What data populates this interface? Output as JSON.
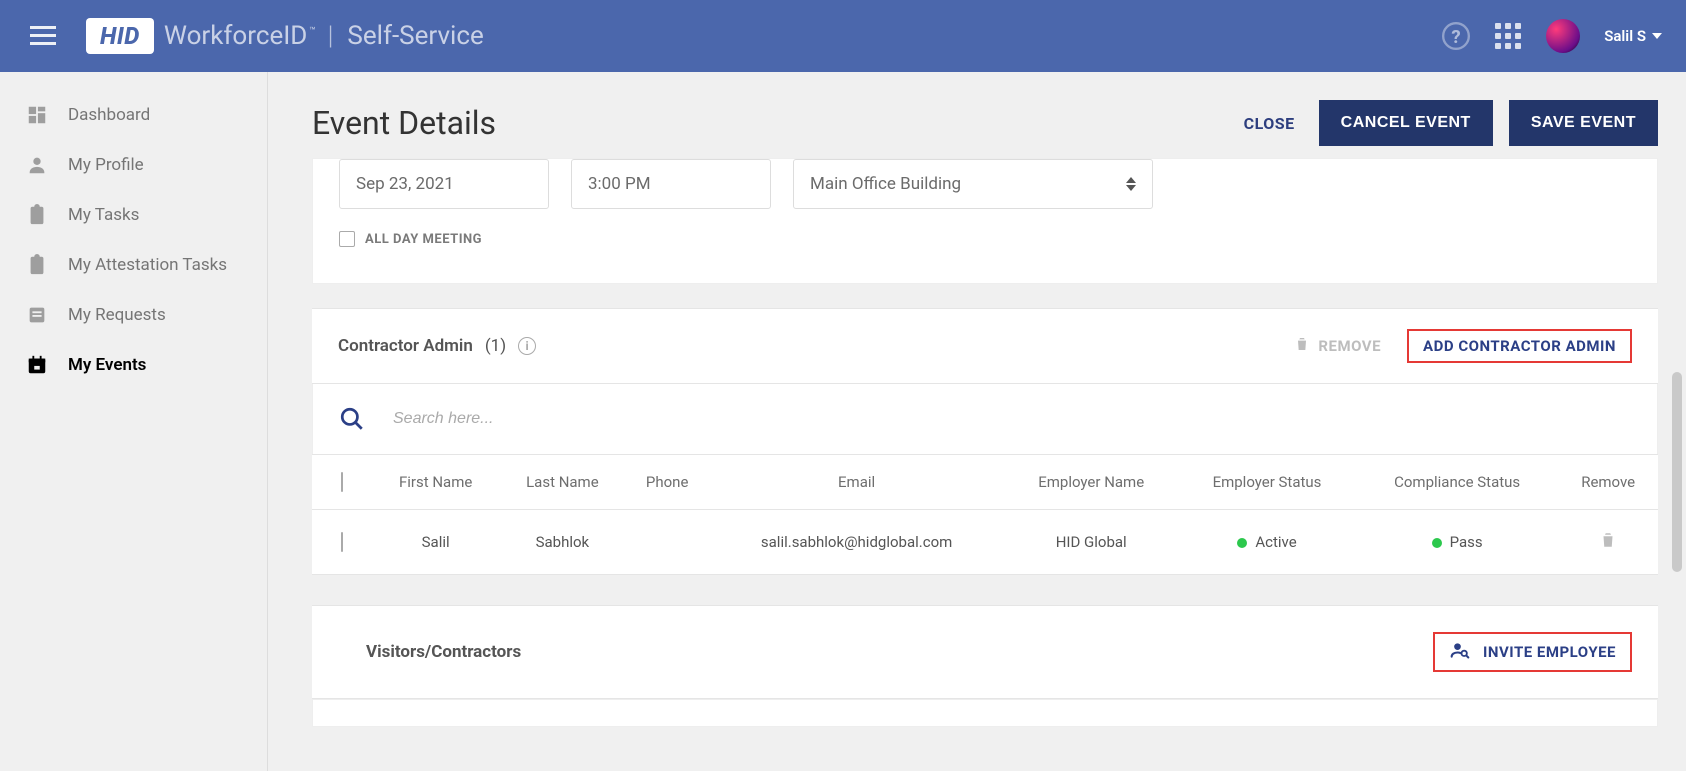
{
  "header": {
    "logo_text": "HID",
    "brand": "WorkforceID",
    "app": "Self-Service",
    "user_name": "Salil S"
  },
  "sidebar": {
    "items": [
      {
        "id": "dashboard",
        "label": "Dashboard"
      },
      {
        "id": "profile",
        "label": "My Profile"
      },
      {
        "id": "tasks",
        "label": "My Tasks"
      },
      {
        "id": "attestation",
        "label": "My Attestation Tasks"
      },
      {
        "id": "requests",
        "label": "My Requests"
      },
      {
        "id": "events",
        "label": "My Events"
      }
    ],
    "active_index": 5
  },
  "page": {
    "title": "Event Details",
    "close": "CLOSE",
    "cancel": "CANCEL EVENT",
    "save": "SAVE EVENT"
  },
  "event": {
    "date": "Sep 23, 2021",
    "time": "3:00 PM",
    "location": "Main Office Building",
    "all_day_label": "ALL DAY MEETING"
  },
  "admin_section": {
    "title": "Contractor Admin",
    "count": "(1)",
    "remove": "REMOVE",
    "add": "ADD CONTRACTOR ADMIN",
    "search_placeholder": "Search here...",
    "columns": {
      "first": "First Name",
      "last": "Last Name",
      "phone": "Phone",
      "email": "Email",
      "employer": "Employer Name",
      "emp_status": "Employer Status",
      "compliance": "Compliance Status",
      "remove": "Remove"
    },
    "rows": [
      {
        "first": "Salil",
        "last": "Sabhlok",
        "phone": "",
        "email": "salil.sabhlok@hidglobal.com",
        "employer": "HID Global",
        "emp_status": "Active",
        "compliance": "Pass"
      }
    ]
  },
  "visitors": {
    "title": "Visitors/Contractors",
    "invite": "INVITE EMPLOYEE"
  }
}
